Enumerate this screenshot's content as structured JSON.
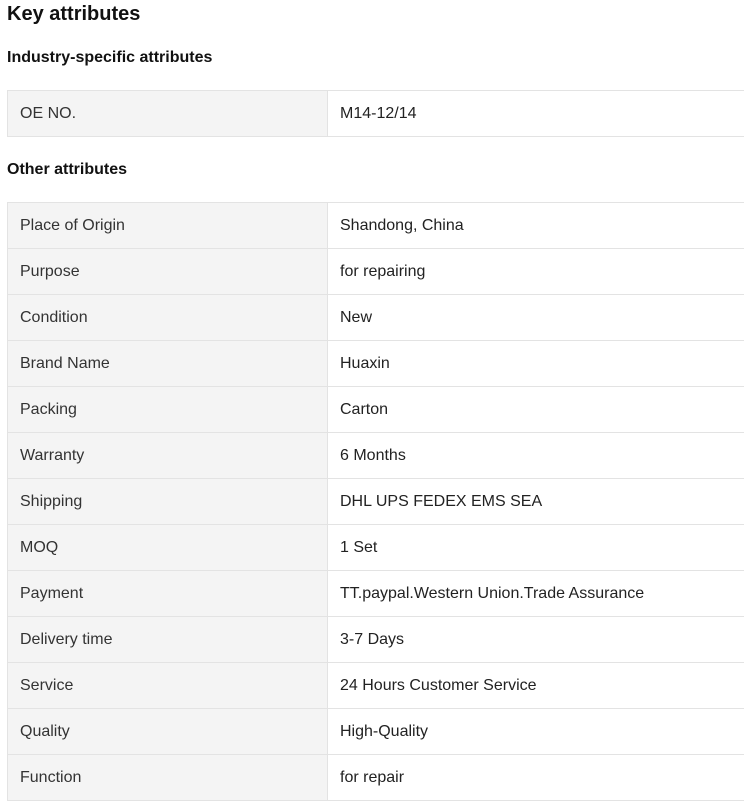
{
  "title": "Key attributes",
  "industry_section": {
    "heading": "Industry-specific attributes",
    "rows": [
      {
        "name": "OE NO.",
        "value": "M14-12/14"
      }
    ]
  },
  "other_section": {
    "heading": "Other attributes",
    "rows": [
      {
        "name": "Place of Origin",
        "value": "Shandong, China"
      },
      {
        "name": "Purpose",
        "value": "for repairing"
      },
      {
        "name": "Condition",
        "value": "New"
      },
      {
        "name": "Brand Name",
        "value": "Huaxin"
      },
      {
        "name": "Packing",
        "value": "Carton"
      },
      {
        "name": "Warranty",
        "value": "6 Months"
      },
      {
        "name": "Shipping",
        "value": "DHL UPS FEDEX EMS SEA"
      },
      {
        "name": "MOQ",
        "value": "1 Set"
      },
      {
        "name": "Payment",
        "value": "TT.paypal.Western Union.Trade Assurance"
      },
      {
        "name": "Delivery time",
        "value": "3-7 Days"
      },
      {
        "name": "Service",
        "value": "24 Hours Customer Service"
      },
      {
        "name": "Quality",
        "value": "High-Quality"
      },
      {
        "name": "Function",
        "value": "for repair"
      }
    ]
  }
}
